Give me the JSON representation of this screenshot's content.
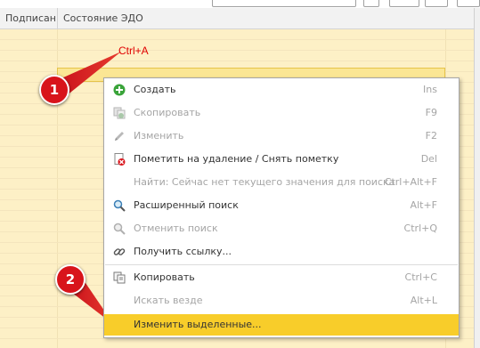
{
  "grid": {
    "columns": [
      "Подписан",
      "Состояние ЭДО"
    ]
  },
  "annotation": {
    "hotkey": "Ctrl+A",
    "badges": [
      "1",
      "2"
    ]
  },
  "colors": {
    "accent_red": "#d8141b",
    "highlight": "#f8cd2a",
    "row_bg": "#fdf0c6"
  },
  "menu": {
    "items": [
      {
        "label": "Создать",
        "shortcut": "Ins",
        "icon": "add-icon",
        "enabled": true
      },
      {
        "label": "Скопировать",
        "shortcut": "F9",
        "icon": "copy-icon",
        "enabled": false
      },
      {
        "label": "Изменить",
        "shortcut": "F2",
        "icon": "pencil-icon",
        "enabled": false
      },
      {
        "label": "Пометить на удаление / Снять пометку",
        "shortcut": "Del",
        "icon": "delete-mark-icon",
        "enabled": true
      },
      {
        "label": "Найти: Сейчас нет текущего значения для поиска",
        "shortcut": "Ctrl+Alt+F",
        "icon": "",
        "enabled": false
      },
      {
        "label": "Расширенный поиск",
        "shortcut": "Alt+F",
        "icon": "search-icon",
        "enabled": true
      },
      {
        "label": "Отменить поиск",
        "shortcut": "Ctrl+Q",
        "icon": "cancel-search-icon",
        "enabled": false
      },
      {
        "label": "Получить ссылку...",
        "shortcut": "",
        "icon": "link-icon",
        "enabled": true
      },
      {
        "label": "Копировать",
        "shortcut": "Ctrl+C",
        "icon": "clipboard-copy-icon",
        "enabled": true
      },
      {
        "label": "Искать везде",
        "shortcut": "Alt+L",
        "icon": "",
        "enabled": false
      },
      {
        "label": "Изменить выделенные...",
        "shortcut": "",
        "icon": "",
        "enabled": true,
        "highlighted": true
      }
    ]
  }
}
